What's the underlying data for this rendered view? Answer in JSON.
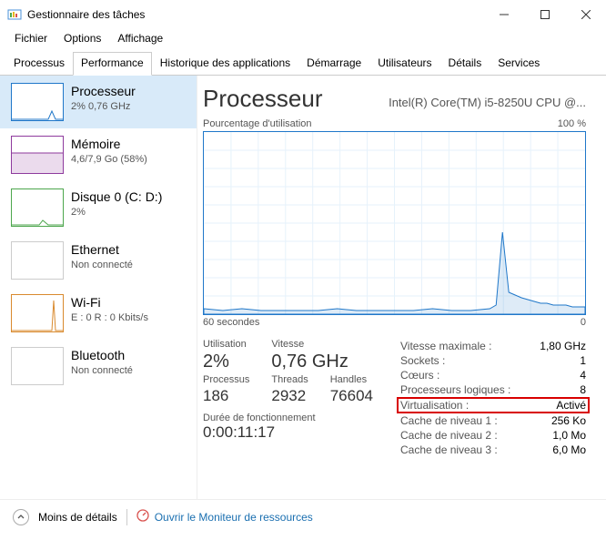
{
  "window": {
    "title": "Gestionnaire des tâches"
  },
  "menu": {
    "file": "Fichier",
    "options": "Options",
    "view": "Affichage"
  },
  "tabs": {
    "items": [
      "Processus",
      "Performance",
      "Historique des applications",
      "Démarrage",
      "Utilisateurs",
      "Détails",
      "Services"
    ],
    "active_index": 1
  },
  "sidebar": [
    {
      "title": "Processeur",
      "sub": "2% 0,76 GHz",
      "color": "#1f77c9",
      "selected": true
    },
    {
      "title": "Mémoire",
      "sub": "4,6/7,9 Go (58%)",
      "color": "#8e3a9d",
      "selected": false
    },
    {
      "title": "Disque 0 (C: D:)",
      "sub": "2%",
      "color": "#4ca64c",
      "selected": false
    },
    {
      "title": "Ethernet",
      "sub": "Non connecté",
      "color": "#cccccc",
      "selected": false
    },
    {
      "title": "Wi-Fi",
      "sub": "E : 0 R : 0 Kbits/s",
      "color": "#d98a2e",
      "selected": false
    },
    {
      "title": "Bluetooth",
      "sub": "Non connecté",
      "color": "#cccccc",
      "selected": false
    }
  ],
  "main": {
    "heading": "Processeur",
    "cpu_name": "Intel(R) Core(TM) i5-8250U CPU @...",
    "chart_top_left": "Pourcentage d'utilisation",
    "chart_top_right": "100 %",
    "chart_bottom_left": "60 secondes",
    "chart_bottom_right": "0"
  },
  "left_stats": {
    "util_label": "Utilisation",
    "util_value": "2%",
    "speed_label": "Vitesse",
    "speed_value": "0,76 GHz",
    "proc_label": "Processus",
    "proc_value": "186",
    "threads_label": "Threads",
    "threads_value": "2932",
    "handles_label": "Handles",
    "handles_value": "76604",
    "uptime_label": "Durée de fonctionnement",
    "uptime_value": "0:00:11:17"
  },
  "right_stats": [
    {
      "k": "Vitesse maximale :",
      "v": "1,80 GHz",
      "hl": false
    },
    {
      "k": "Sockets :",
      "v": "1",
      "hl": false
    },
    {
      "k": "Cœurs :",
      "v": "4",
      "hl": false
    },
    {
      "k": "Processeurs logiques :",
      "v": "8",
      "hl": false
    },
    {
      "k": "Virtualisation :",
      "v": "Activé",
      "hl": true
    },
    {
      "k": "Cache de niveau 1 :",
      "v": "256 Ko",
      "hl": false
    },
    {
      "k": "Cache de niveau 2 :",
      "v": "1,0 Mo",
      "hl": false
    },
    {
      "k": "Cache de niveau 3 :",
      "v": "6,0 Mo",
      "hl": false
    }
  ],
  "footer": {
    "less_details": "Moins de détails",
    "open_monitor": "Ouvrir le Moniteur de ressources"
  },
  "chart_data": {
    "type": "area",
    "title": "Pourcentage d'utilisation",
    "xlabel": "secondes",
    "ylabel": "%",
    "ylim": [
      0,
      100
    ],
    "xlim": [
      60,
      0
    ],
    "x": [
      60,
      57,
      54,
      51,
      48,
      45,
      42,
      39,
      36,
      33,
      30,
      27,
      24,
      21,
      18,
      15,
      14,
      13,
      12,
      10,
      9,
      8,
      7,
      6,
      5,
      4,
      3,
      2,
      1,
      0
    ],
    "values": [
      3,
      2,
      3,
      2,
      2,
      2,
      2,
      3,
      2,
      2,
      2,
      2,
      3,
      2,
      2,
      3,
      5,
      45,
      12,
      9,
      8,
      7,
      6,
      6,
      5,
      5,
      5,
      4,
      4,
      4
    ]
  }
}
